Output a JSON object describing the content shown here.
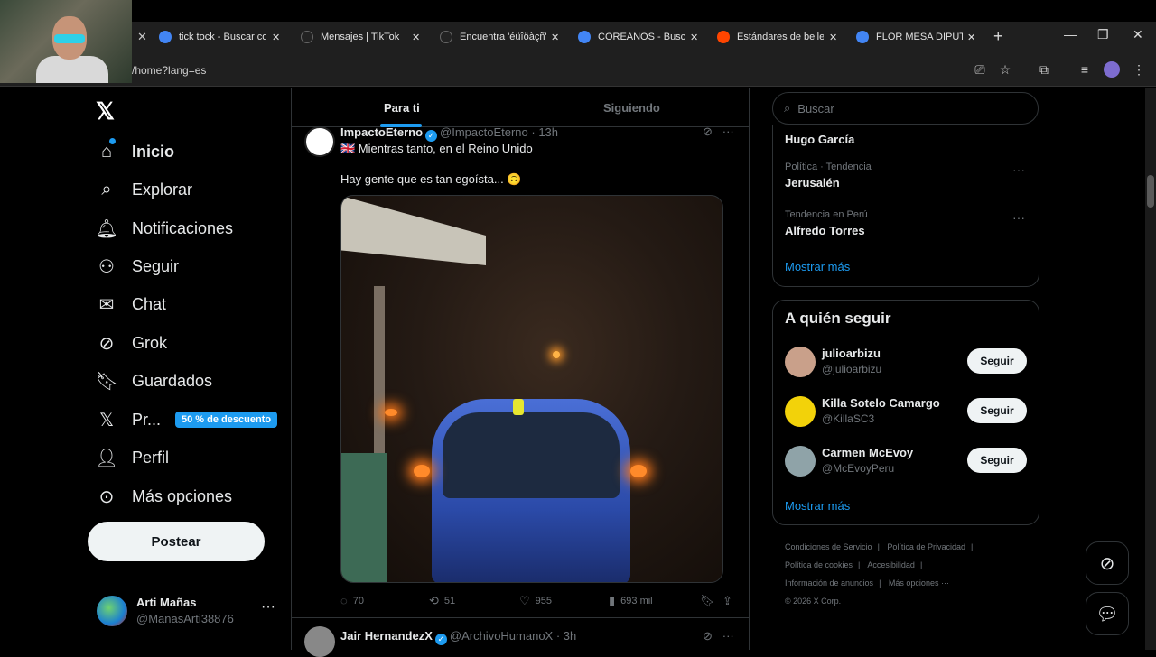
{
  "browser": {
    "tabs": [
      {
        "title": "tick tock - Buscar con",
        "color": "#4285f4"
      },
      {
        "title": "Mensajes | TikTok",
        "color": "#111111"
      },
      {
        "title": "Encuentra 'éüîöàçñ' ...",
        "color": "#111111"
      },
      {
        "title": "COREANOS - Buscar",
        "color": "#4285f4"
      },
      {
        "title": "Estándares de belleza",
        "color": "#ff4500"
      },
      {
        "title": "FLOR MESA DIPUTADA",
        "color": "#4285f4"
      }
    ],
    "url": "/home?lang=es"
  },
  "nav": {
    "items": [
      {
        "label": "Inicio",
        "icon": "home-icon"
      },
      {
        "label": "Explorar",
        "icon": "search-icon"
      },
      {
        "label": "Notificaciones",
        "icon": "bell-icon"
      },
      {
        "label": "Seguir",
        "icon": "add-user-icon"
      },
      {
        "label": "Chat",
        "icon": "mail-icon"
      },
      {
        "label": "Grok",
        "icon": "grok-icon"
      },
      {
        "label": "Guardados",
        "icon": "bookmark-icon"
      },
      {
        "label": "Pr...",
        "icon": "x-icon"
      },
      {
        "label": "Perfil",
        "icon": "person-icon"
      },
      {
        "label": "Más opciones",
        "icon": "more-circle-icon"
      }
    ],
    "premium_badge": "50 % de descuento",
    "post_button": "Postear",
    "account": {
      "name": "Arti Mañas",
      "handle": "@ManasArti38876"
    }
  },
  "feed": {
    "tabs": [
      "Para ti",
      "Siguiendo"
    ],
    "post": {
      "name": "ImpactoEterno",
      "handle": "@ImpactoEterno",
      "time": "· 13h",
      "line1": "🇬🇧 Mientras tanto, en el Reino Unido",
      "line2": "Hay gente que es tan egoísta... 🙃",
      "replies": "70",
      "reposts": "51",
      "likes": "955",
      "views": "693 mil"
    },
    "next_post": {
      "name": "Jair HernandezX",
      "handle": "@ArchivoHumanoX",
      "time": "· 3h"
    }
  },
  "sidebar": {
    "search_placeholder": "Buscar",
    "trends": [
      {
        "meta": "",
        "title": "Hugo García"
      },
      {
        "meta": "Política · Tendencia",
        "title": "Jerusalén"
      },
      {
        "meta": "Tendencia en Perú",
        "title": "Alfredo Torres"
      }
    ],
    "show_more": "Mostrar más",
    "who_to_follow_title": "A quién seguir",
    "suggestions": [
      {
        "name": "julioarbizu",
        "handle": "@julioarbizu",
        "color": "#c9a08a"
      },
      {
        "name": "Killa Sotelo Camargo",
        "handle": "@KillaSC3",
        "color": "#f2d20a"
      },
      {
        "name": "Carmen McEvoy",
        "handle": "@McEvoyPeru",
        "color": "#8fa3a8"
      }
    ],
    "follow_label": "Seguir",
    "show_more_2": "Mostrar más",
    "footer": {
      "l1": [
        "Condiciones de Servicio",
        "|",
        "Política de Privacidad",
        "|"
      ],
      "l2": [
        "Política de cookies",
        "|",
        "Accesibilidad",
        "|"
      ],
      "l3": [
        "Información de anuncios",
        "|",
        "Más opciones ···"
      ],
      "copyright": "© 2026 X Corp."
    }
  },
  "accent": "#1d9bf0"
}
